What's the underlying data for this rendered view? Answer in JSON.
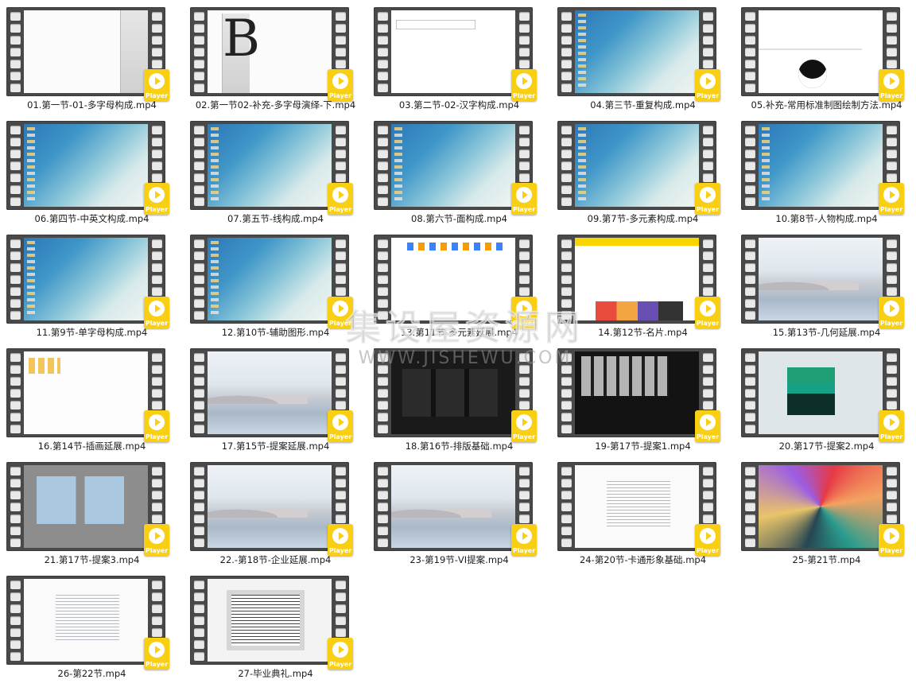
{
  "badge_label": "Player",
  "colors": {
    "badge": "#f9cf13",
    "film": "#494949",
    "background": "#ffffff"
  },
  "watermark": {
    "title": "集设屋资源网",
    "url": "WWW.JISHEWU.COM"
  },
  "files": [
    {
      "name": "01.第一节-01-多字母构成.mp4",
      "thumb": "white"
    },
    {
      "name": "02.第一节02-补充-多字母演绎-下.mp4",
      "thumb": "white bigletter"
    },
    {
      "name": "03.第二节-02-汉字构成.mp4",
      "thumb": "ui3"
    },
    {
      "name": "04.第三节-重复构成.mp4",
      "thumb": "desktop"
    },
    {
      "name": "05.补充-常用标准制图绘制方法.mp4",
      "thumb": "logo"
    },
    {
      "name": "06.第四节-中英文构成.mp4",
      "thumb": "desktop"
    },
    {
      "name": "07.第五节-线构成.mp4",
      "thumb": "desktop"
    },
    {
      "name": "08.第六节-面构成.mp4",
      "thumb": "desktop"
    },
    {
      "name": "09.第7节-多元素构成.mp4",
      "thumb": "desktop"
    },
    {
      "name": "10.第8节-人物构成.mp4",
      "thumb": "desktop"
    },
    {
      "name": "11.第9节-单字母构成.mp4",
      "thumb": "desktop"
    },
    {
      "name": "12.第10节-辅助图形.mp4",
      "thumb": "desktop"
    },
    {
      "name": "13.第11节-多元素延展.mp4",
      "thumb": "icons"
    },
    {
      "name": "14.第12节-名片.mp4",
      "thumb": "yellow"
    },
    {
      "name": "15.第13节-几何延展.mp4",
      "thumb": "desert panel"
    },
    {
      "name": "16.第14节-插画延展.mp4",
      "thumb": "explorer"
    },
    {
      "name": "17.第15节-提案延展.mp4",
      "thumb": "desert"
    },
    {
      "name": "18.第16节-排版基础.mp4",
      "thumb": "dark"
    },
    {
      "name": "19-第17节-提案1.mp4",
      "thumb": "grid"
    },
    {
      "name": "20.第17节-提案2.mp4",
      "thumb": "green"
    },
    {
      "name": "21.第17节-提案3.mp4",
      "thumb": "gray"
    },
    {
      "name": "22.-第18节-企业延展.mp4",
      "thumb": "desert panel"
    },
    {
      "name": "23-第19节-VI提案.mp4",
      "thumb": "desert"
    },
    {
      "name": "24-第20节-卡通形象基础.mp4",
      "thumb": "list"
    },
    {
      "name": "25-第21节.mp4",
      "thumb": "colorful"
    },
    {
      "name": "26-第22节.mp4",
      "thumb": "list"
    },
    {
      "name": "27-毕业典礼.mp4",
      "thumb": "tunnel"
    }
  ]
}
